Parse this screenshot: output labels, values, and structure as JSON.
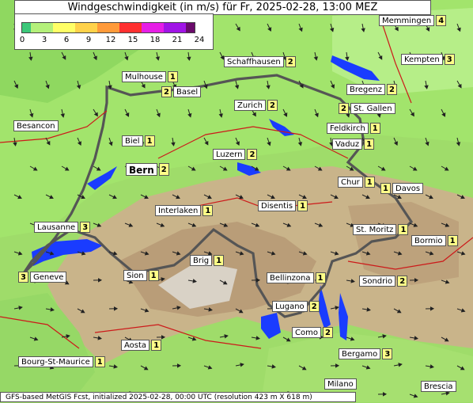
{
  "title": "Windgeschwindigkeit (in m/s) für Fr, 2025-02-28, 13:00 MEZ",
  "legend": {
    "ticks": [
      "0",
      "3",
      "6",
      "9",
      "12",
      "15",
      "18",
      "21",
      "24"
    ],
    "colors": [
      "#3cc87a",
      "#b4f07a",
      "#ffff66",
      "#ffd24a",
      "#ff9a3a",
      "#ff3030",
      "#e61ee6",
      "#a014e6",
      "#6a0a6a"
    ]
  },
  "footer": "GFS-based MetGIS Fcst, initialized 2025-02-28, 00:00 UTC  (resolution 423 m X 618 m)",
  "places": [
    {
      "name": "Memmingen",
      "value": "4"
    },
    {
      "name": "Schaffhausen",
      "value": "2"
    },
    {
      "name": "Kempten",
      "value": "3"
    },
    {
      "name": "Mulhouse",
      "value": "1"
    },
    {
      "name": "Basel",
      "value": "2"
    },
    {
      "name": "Bregenz",
      "value": "2"
    },
    {
      "name": "Zurich",
      "value": "2"
    },
    {
      "name": "St. Gallen",
      "value": "2"
    },
    {
      "name": "Besancon",
      "value": ""
    },
    {
      "name": "Feldkirch",
      "value": "1"
    },
    {
      "name": "Biel",
      "value": "1"
    },
    {
      "name": "Vaduz",
      "value": "1"
    },
    {
      "name": "Luzern",
      "value": "2"
    },
    {
      "name": "Bern",
      "value": "2"
    },
    {
      "name": "Chur",
      "value": "1"
    },
    {
      "name": "Davos",
      "value": "1"
    },
    {
      "name": "Disentis",
      "value": "1"
    },
    {
      "name": "Interlaken",
      "value": "1"
    },
    {
      "name": "Lausanne",
      "value": "3"
    },
    {
      "name": "St. Moritz",
      "value": "1"
    },
    {
      "name": "Bormio",
      "value": "1"
    },
    {
      "name": "Brig",
      "value": "1"
    },
    {
      "name": "Geneve",
      "value": "3"
    },
    {
      "name": "Sion",
      "value": "1"
    },
    {
      "name": "Bellinzona",
      "value": "1"
    },
    {
      "name": "Sondrio",
      "value": "2"
    },
    {
      "name": "Lugano",
      "value": "2"
    },
    {
      "name": "Como",
      "value": "2"
    },
    {
      "name": "Aosta",
      "value": "1"
    },
    {
      "name": "Bergamo",
      "value": "3"
    },
    {
      "name": "Bourg-St-Maurice",
      "value": "1"
    },
    {
      "name": "Milano",
      "value": ""
    },
    {
      "name": "Brescia",
      "value": ""
    }
  ]
}
